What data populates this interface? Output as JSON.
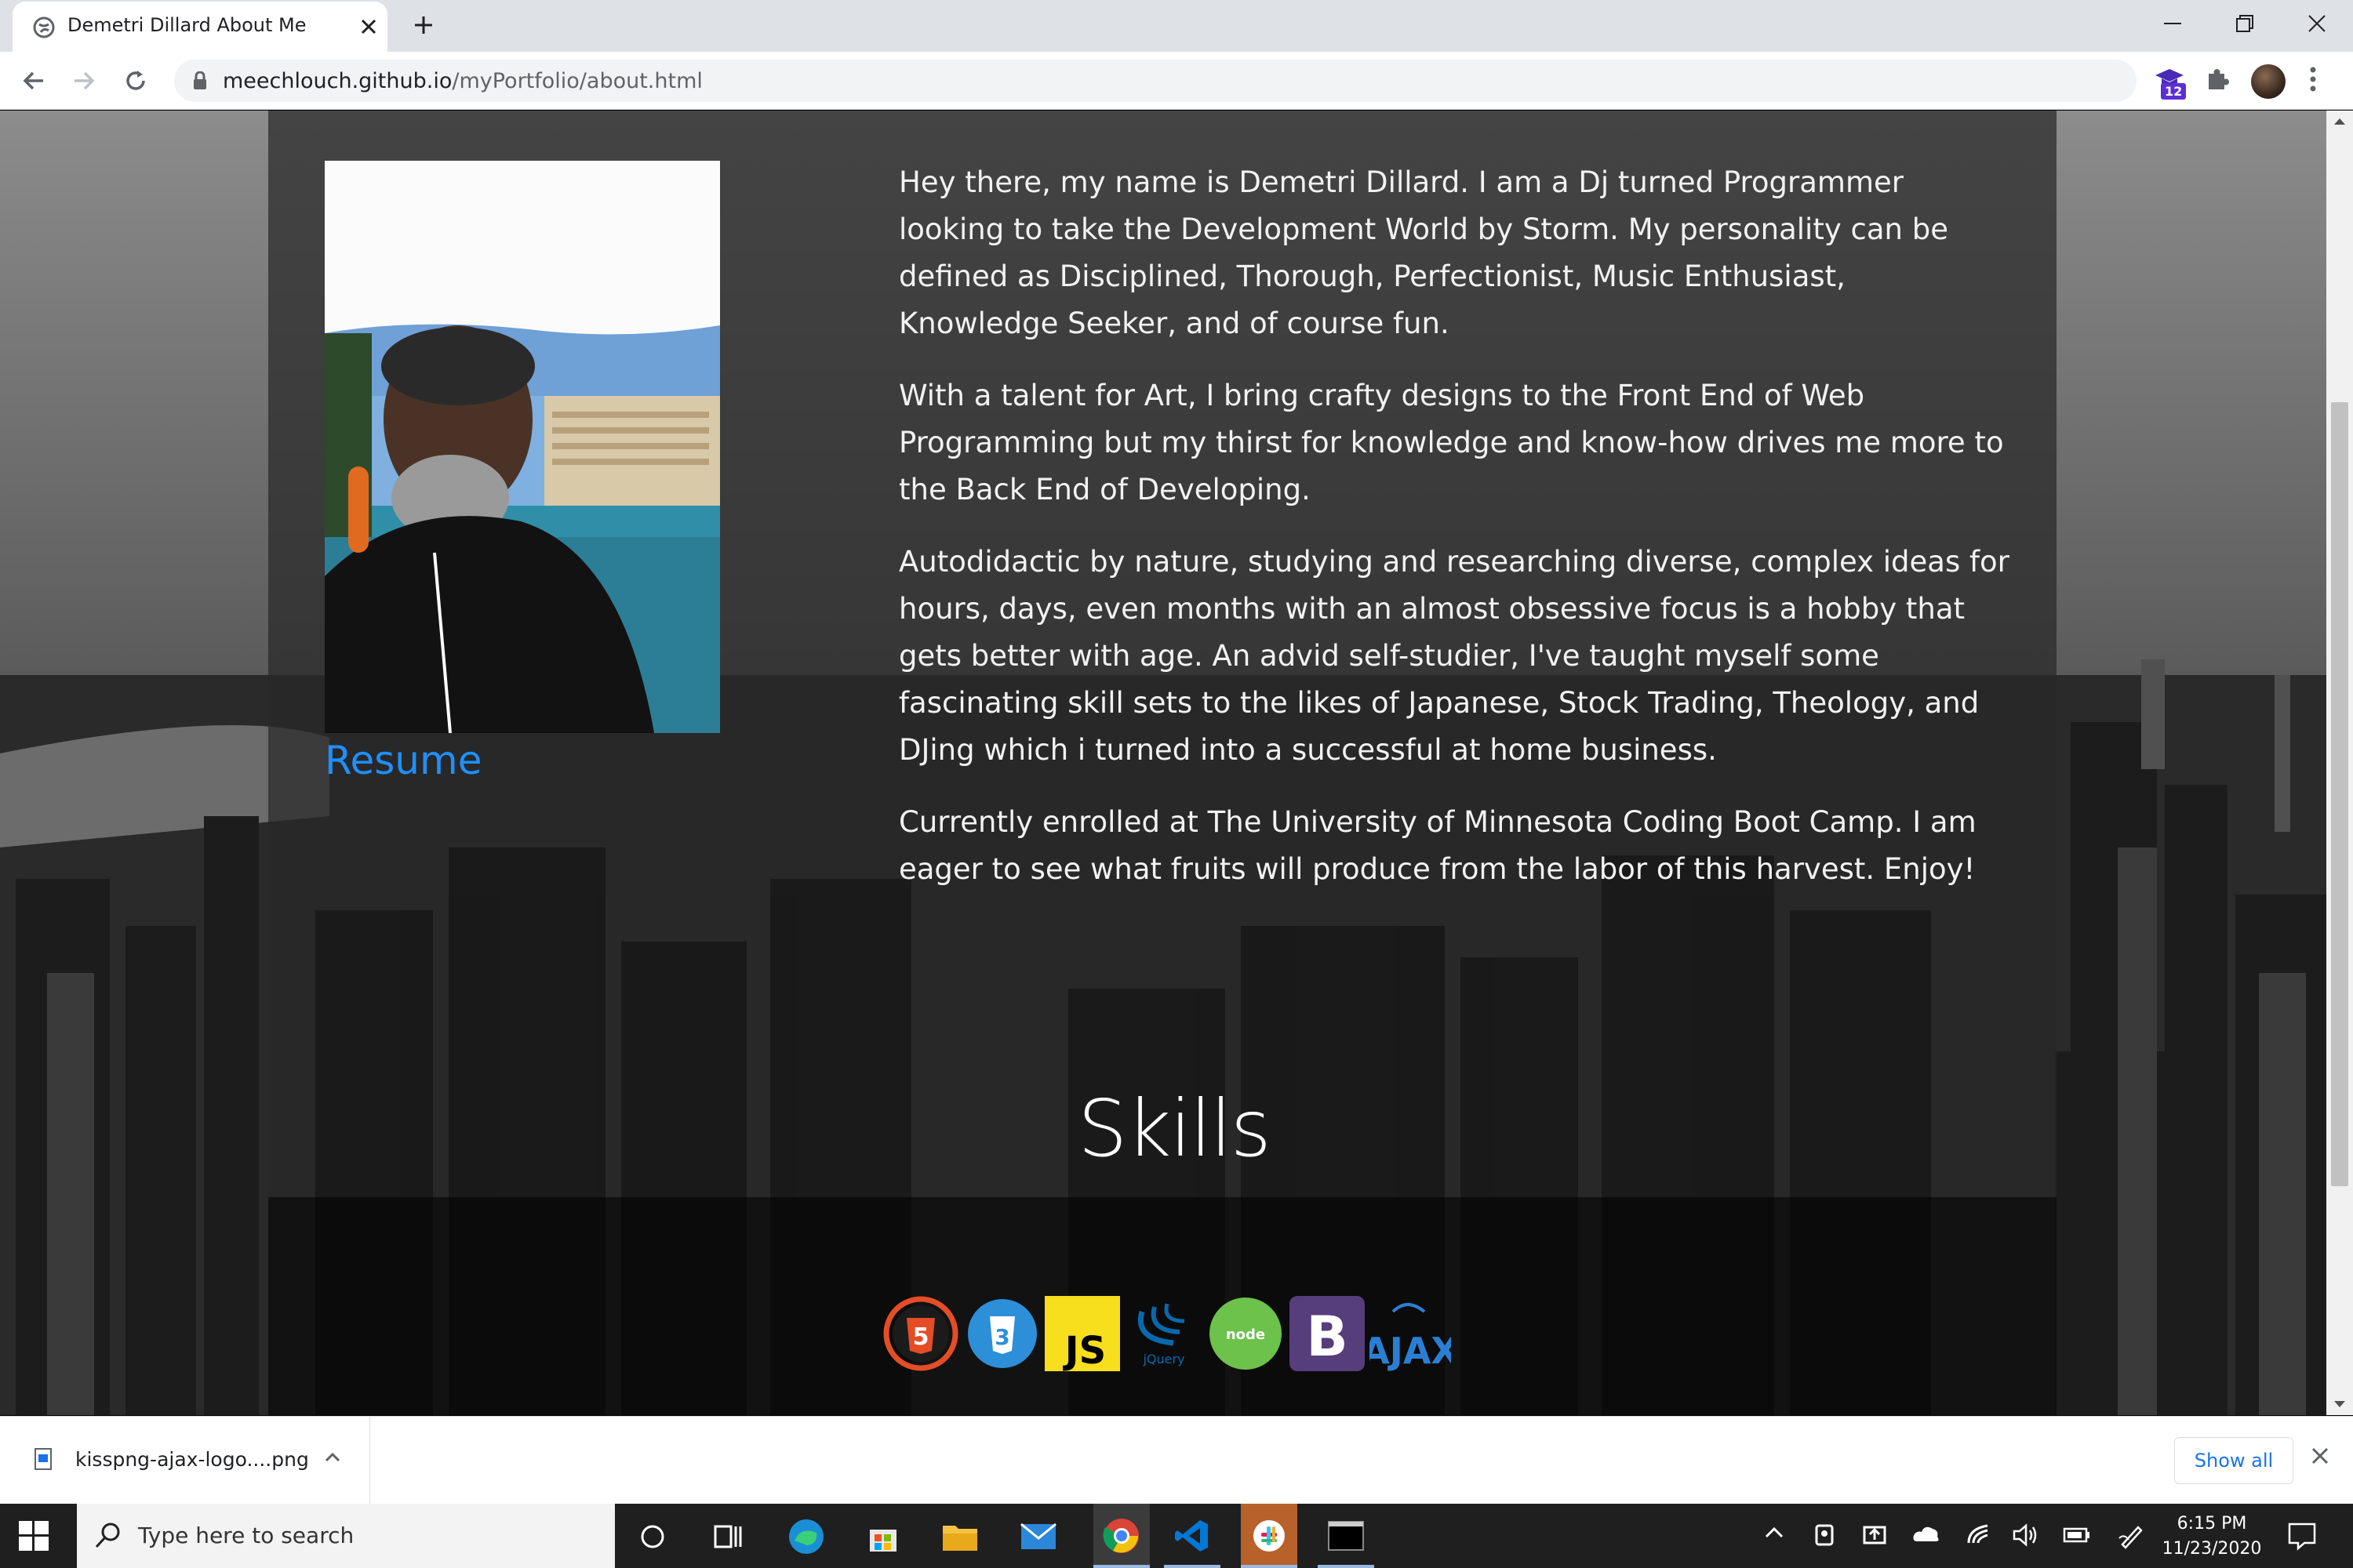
{
  "browser": {
    "tab_title": "Demetri Dillard About Me",
    "url_host": "meechlouch.github.io",
    "url_path": "/myPortfolio/about.html",
    "extension_badge": "12"
  },
  "page": {
    "resume_link": "Resume",
    "bio": [
      "Hey there, my name is Demetri Dillard. I am a Dj turned Programmer looking to take the Development World by Storm. My personality can be defined as Disciplined, Thorough, Perfectionist, Music Enthusiast, Knowledge Seeker, and of course fun.",
      "With a talent for Art, I bring crafty designs to the Front End of Web Programming but my thirst for knowledge and know-how drives me more to the Back End of Developing.",
      "Autodidactic by nature, studying and researching diverse, complex ideas for hours, days, even months with an almost obsessive focus is a hobby that gets better with age. An advid self-studier, I've taught myself some fascinating skill sets to the likes of Japanese, Stock Trading, Theology, and DJing which i turned into a successful at home business.",
      "Currently enrolled at The University of Minnesota Coding Boot Camp. I am eager to see what fruits will produce from the labor of this harvest. Enjoy!"
    ],
    "skills_title": "Skills",
    "skills": [
      {
        "name": "html5-icon",
        "label": "HTML",
        "color": "#e44d26"
      },
      {
        "name": "css3-icon",
        "label": "CSS",
        "color": "#2965f1"
      },
      {
        "name": "javascript-icon",
        "label": "JS",
        "color": "#f7df1e"
      },
      {
        "name": "jquery-icon",
        "label": "jQuery",
        "color": "#0769ad"
      },
      {
        "name": "nodejs-icon",
        "label": "node",
        "color": "#6cc24a"
      },
      {
        "name": "bootstrap-icon",
        "label": "B",
        "color": "#563d7c"
      },
      {
        "name": "ajax-icon",
        "label": "AJAX",
        "color": "#2a7fd4"
      }
    ]
  },
  "downloads": {
    "file_name": "kisspng-ajax-logo....png",
    "show_all": "Show all"
  },
  "taskbar": {
    "search_placeholder": "Type here to search",
    "time": "6:15 PM",
    "date": "11/23/2020"
  }
}
